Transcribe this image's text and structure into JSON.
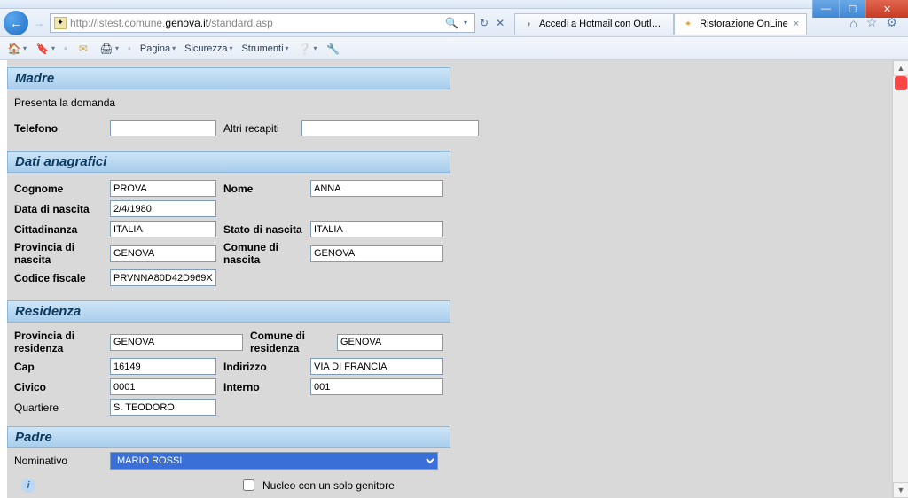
{
  "window": {
    "min_icon": "—",
    "max_icon": "☐",
    "close_icon": "✕"
  },
  "nav": {
    "back_icon": "←",
    "fwd_icon": "→",
    "favicon_glyph": "✦",
    "url_dim_prefix": "http://istest.comune.",
    "url_bold_host": "genova.it",
    "url_dim_path": "/standard.asp",
    "search_glyph": "🔍",
    "refresh_glyph": "↻",
    "stop_glyph": "✕",
    "dropdown_glyph": "▾",
    "home_glyph": "⌂",
    "star_glyph": "☆",
    "gear_glyph": "⚙"
  },
  "tabs": [
    {
      "favicon": "◑",
      "label": "Accedi a Hotmail con Outlook,..."
    },
    {
      "favicon": "✦",
      "label": "Ristorazione OnLine",
      "close": "×"
    }
  ],
  "cmdbar": {
    "home_glyph": "🏠",
    "feeds_glyph": "🔖",
    "mail_glyph": "✉",
    "print_glyph": "🖨",
    "page_label": "Pagina",
    "safety_label": "Sicurezza",
    "tools_label": "Strumenti",
    "help_glyph": "❔",
    "extra_glyph": "🔧",
    "drop": "▾",
    "sep": "▪"
  },
  "form": {
    "sections": {
      "madre": "Madre",
      "dati": "Dati anagrafici",
      "residenza": "Residenza",
      "padre": "Padre"
    },
    "presenta": "Presenta la domanda",
    "labels": {
      "telefono": "Telefono",
      "altri_recapiti": "Altri recapiti",
      "cognome": "Cognome",
      "nome": "Nome",
      "data_nascita": "Data di nascita",
      "cittadinanza": "Cittadinanza",
      "stato_nascita": "Stato di nascita",
      "prov_nascita": "Provincia di nascita",
      "comune_nascita": "Comune di nascita",
      "codice_fiscale": "Codice fiscale",
      "prov_residenza": "Provincia di residenza",
      "comune_residenza": "Comune di residenza",
      "cap": "Cap",
      "indirizzo": "Indirizzo",
      "civico": "Civico",
      "interno": "Interno",
      "quartiere": "Quartiere",
      "nominativo": "Nominativo",
      "nucleo_chk": "Nucleo con un solo genitore"
    },
    "values": {
      "telefono": "",
      "altri_recapiti": "",
      "cognome": "PROVA",
      "nome": "ANNA",
      "data_nascita": "2/4/1980",
      "cittadinanza": "ITALIA",
      "stato_nascita": "ITALIA",
      "prov_nascita": "GENOVA",
      "comune_nascita": "GENOVA",
      "codice_fiscale": "PRVNNA80D42D969X",
      "prov_residenza": "GENOVA",
      "comune_residenza": "GENOVA",
      "cap": "16149",
      "indirizzo": "VIA DI FRANCIA",
      "civico": "0001",
      "interno": "001",
      "quartiere": "S. TEODORO",
      "nominativo": "MARIO ROSSI"
    },
    "info_glyph": "i",
    "scroll_up": "▲",
    "scroll_down": "▼"
  }
}
